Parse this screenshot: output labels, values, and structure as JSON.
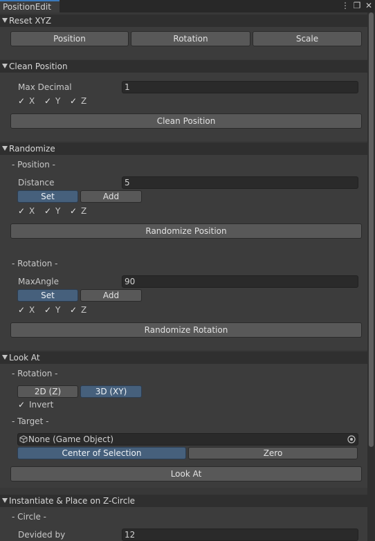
{
  "window": {
    "tab_title": "PositionEdit",
    "icons": [
      "kebab-menu-icon",
      "maximize-icon",
      "close-icon"
    ],
    "icon_glyphs": [
      "⋮",
      "❐",
      "✕"
    ]
  },
  "reset": {
    "title": "Reset XYZ",
    "buttons": [
      "Position",
      "Rotation",
      "Scale"
    ]
  },
  "clean": {
    "title": "Clean Position",
    "max_decimal_label": "Max Decimal",
    "max_decimal_value": "1",
    "axes": [
      "X",
      "Y",
      "Z"
    ],
    "button": "Clean Position"
  },
  "randomize": {
    "title": "Randomize",
    "position_sub": "- Position -",
    "distance_label": "Distance",
    "distance_value": "5",
    "set_label": "Set",
    "add_label": "Add",
    "axes": [
      "X",
      "Y",
      "Z"
    ],
    "position_button": "Randomize Position",
    "rotation_sub": "- Rotation -",
    "maxangle_label": "MaxAngle",
    "maxangle_value": "90",
    "rotation_button": "Randomize Rotation"
  },
  "lookat": {
    "title": "Look At",
    "rotation_sub": "- Rotation -",
    "mode_2d": "2D (Z)",
    "mode_3d": "3D (XY)",
    "invert_label": "Invert",
    "target_sub": "- Target -",
    "target_value": "None (Game Object)",
    "center_button": "Center of Selection",
    "zero_button": "Zero",
    "button": "Look At"
  },
  "instantiate": {
    "title": "Instantiate & Place on Z-Circle",
    "circle_sub": "- Circle -",
    "divided_label": "Devided by",
    "divided_value": "12"
  },
  "check_glyph": "✓",
  "colors": {
    "background": "#383838",
    "section_header": "#2f2f2f",
    "button": "#585858",
    "button_active": "#46607c",
    "field": "#2a2a2a",
    "tab_accent": "#3a79bb"
  }
}
